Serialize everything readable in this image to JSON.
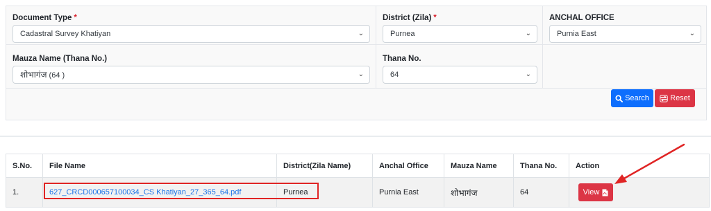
{
  "form": {
    "document_type": {
      "label": "Document Type",
      "required": "*",
      "value": "Cadastral Survey Khatiyan"
    },
    "district": {
      "label": "District (Zila)",
      "required": "*",
      "value": "Purnea"
    },
    "anchal_office": {
      "label": "ANCHAL OFFICE",
      "value": "Purnia East"
    },
    "mauza": {
      "label": "Mauza Name (Thana No.)",
      "value_hindi": "शोभागंज",
      "value_suffix": "(64 )"
    },
    "thana": {
      "label": "Thana No.",
      "value": "64"
    }
  },
  "buttons": {
    "search": "Search",
    "reset": "Reset",
    "view": "View"
  },
  "table": {
    "headers": [
      "S.No.",
      "File Name",
      "District(Zila Name)",
      "Anchal Office",
      "Mauza Name",
      "Thana No.",
      "Action"
    ],
    "rows": [
      {
        "sno": "1.",
        "file_name": "627_CRCD000657100034_CS Khatiyan_27_365_64.pdf",
        "district": "Purnea",
        "anchal_office": "Purnia East",
        "mauza": "शोभागंज",
        "thana": "64"
      }
    ]
  },
  "colors": {
    "primary": "#0d6efd",
    "danger": "#dc3545",
    "annotation": "#e02424"
  },
  "icons": [
    "search-icon",
    "reset-icon",
    "pdf-file-icon",
    "chevron-down-icon"
  ]
}
